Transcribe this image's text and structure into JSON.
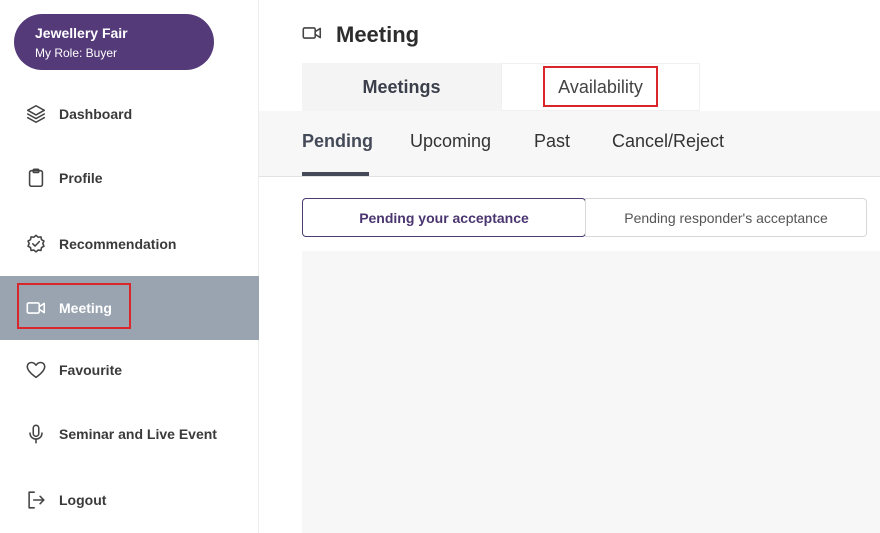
{
  "profile": {
    "name": "Jewellery Fair",
    "role": "My Role: Buyer"
  },
  "sidebar": {
    "items": [
      {
        "label": "Dashboard",
        "icon": "layers-icon"
      },
      {
        "label": "Profile",
        "icon": "clipboard-icon"
      },
      {
        "label": "Recommendation",
        "icon": "badge-check-icon"
      },
      {
        "label": "Meeting",
        "icon": "video-camera-icon",
        "active": true
      },
      {
        "label": "Favourite",
        "icon": "heart-icon"
      },
      {
        "label": "Seminar and Live Event",
        "icon": "microphone-icon"
      },
      {
        "label": "Logout",
        "icon": "logout-icon"
      }
    ]
  },
  "header": {
    "title": "Meeting",
    "icon": "video-camera-icon"
  },
  "top_tabs": [
    {
      "label": "Meetings",
      "active": true
    },
    {
      "label": "Availability",
      "active": false
    }
  ],
  "sub_tabs": [
    {
      "label": "Pending",
      "active": true
    },
    {
      "label": "Upcoming"
    },
    {
      "label": "Past"
    },
    {
      "label": "Cancel/Reject"
    }
  ],
  "segments": [
    {
      "label": "Pending your acceptance",
      "active": true
    },
    {
      "label": "Pending responder's acceptance",
      "active": false
    }
  ],
  "colors": {
    "brand": "#553a7a",
    "active_nav": "#9aa4b1",
    "highlight": "#d9262b"
  }
}
